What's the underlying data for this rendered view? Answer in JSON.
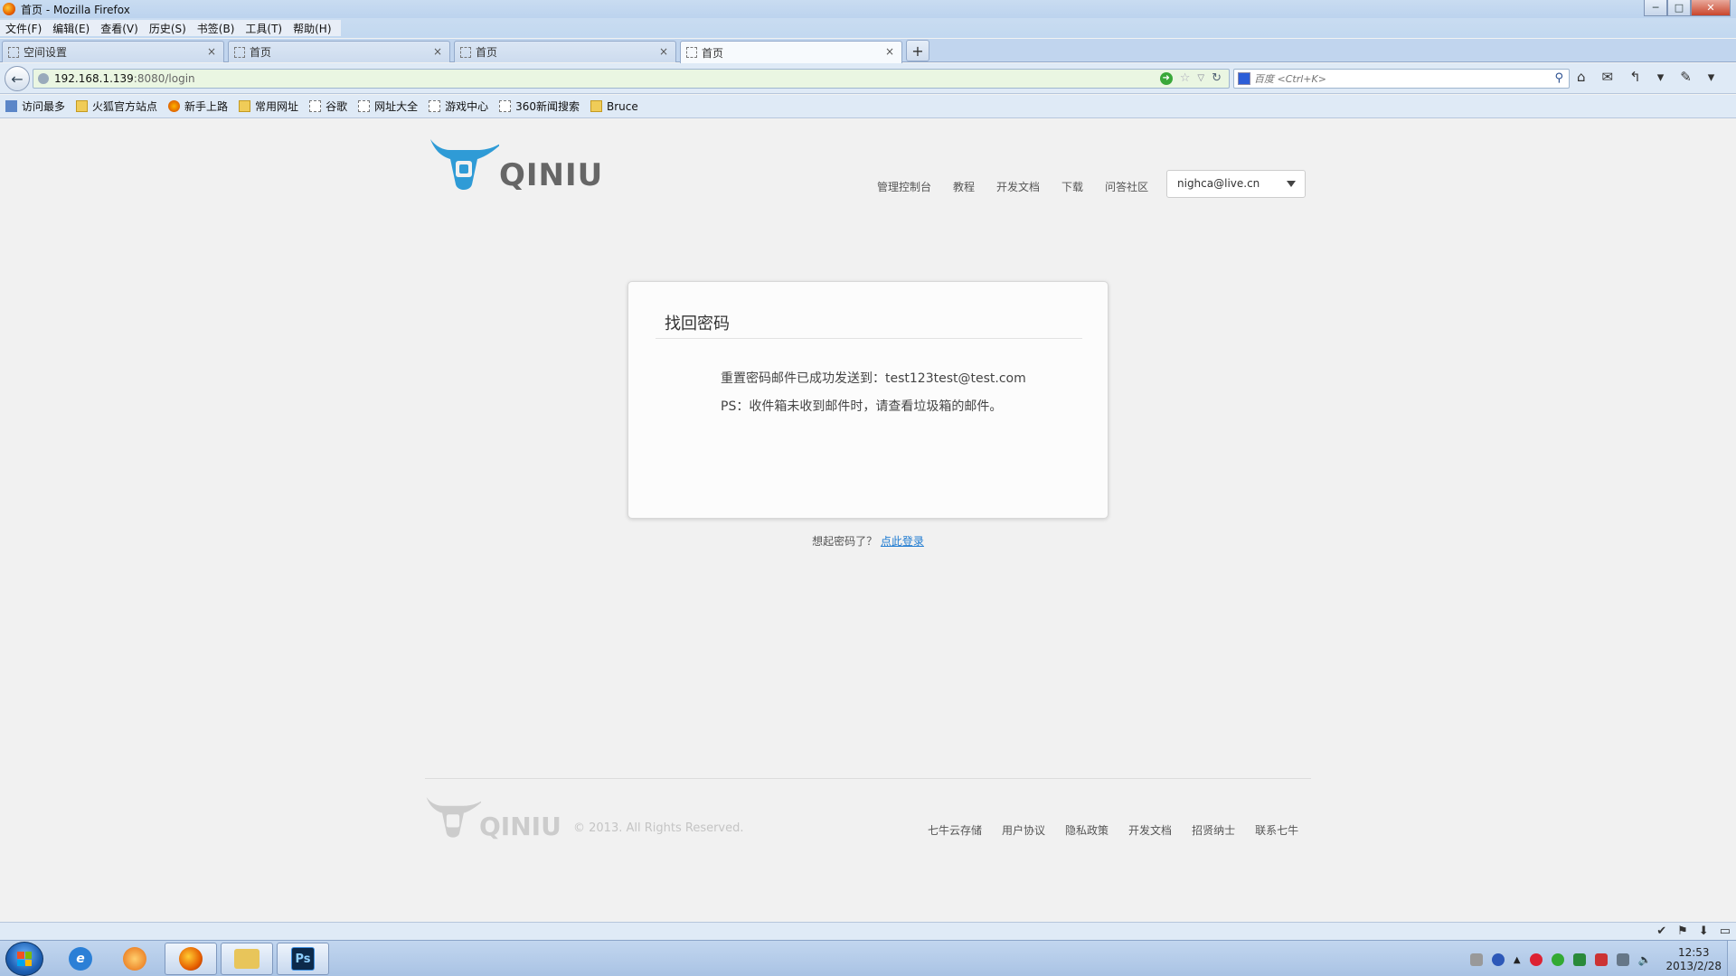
{
  "window": {
    "title": "首页 - Mozilla Firefox",
    "minimize_label": "─",
    "maximize_label": "□",
    "close_label": "✕"
  },
  "menubar": {
    "items": [
      "文件(F)",
      "编辑(E)",
      "查看(V)",
      "历史(S)",
      "书签(B)",
      "工具(T)",
      "帮助(H)"
    ]
  },
  "tabs": [
    {
      "label": "空间设置",
      "close": "×"
    },
    {
      "label": "首页",
      "close": "×"
    },
    {
      "label": "首页",
      "close": "×"
    },
    {
      "label": "首页",
      "close": "×",
      "active": true
    }
  ],
  "new_tab_label": "+",
  "navbar": {
    "back_glyph": "←",
    "url_host": "192.168.1.139",
    "url_path": ":8080/login",
    "search_placeholder": "百度 <Ctrl+K>",
    "tools": [
      "⌂",
      "✉",
      "↰",
      "▾",
      "✎",
      "▾"
    ]
  },
  "bookmarks": [
    {
      "label": "访问最多",
      "icon": "blue"
    },
    {
      "label": "火狐官方站点",
      "icon": "folder"
    },
    {
      "label": "新手上路",
      "icon": "fox"
    },
    {
      "label": "常用网址",
      "icon": "folder"
    },
    {
      "label": "谷歌",
      "icon": "page"
    },
    {
      "label": "网址大全",
      "icon": "page"
    },
    {
      "label": "游戏中心",
      "icon": "page"
    },
    {
      "label": "360新闻搜索",
      "icon": "page"
    },
    {
      "label": "Bruce",
      "icon": "folder"
    }
  ],
  "site": {
    "logo_text": "QINIU",
    "nav": [
      "管理控制台",
      "教程",
      "开发文档",
      "下载",
      "问答社区"
    ],
    "user_email": "nighca@live.cn"
  },
  "card": {
    "title": "找回密码",
    "message_line1": "重置密码邮件已成功发送到：test123test@test.com",
    "message_line2": "PS：收件箱未收到邮件时，请查看垃圾箱的邮件。"
  },
  "remember": {
    "prompt": "想起密码了？",
    "link_label": "点此登录"
  },
  "footer": {
    "logo_text": "QINIU",
    "copyright": "© 2013. All Rights Reserved.",
    "links": [
      "七牛云存储",
      "用户协议",
      "隐私政策",
      "开发文档",
      "招贤纳士",
      "联系七牛"
    ]
  },
  "taskbar": {
    "apps": [
      "internet-explorer",
      "app-swirl",
      "firefox",
      "file-explorer",
      "photoshop"
    ],
    "photoshop_label": "Ps",
    "clock_time": "12:53",
    "clock_date": "2013/2/28"
  },
  "colors": {
    "link": "#1f7bd1",
    "logo_blue": "#2f9bd6",
    "page_bg": "#f1f1f1"
  }
}
